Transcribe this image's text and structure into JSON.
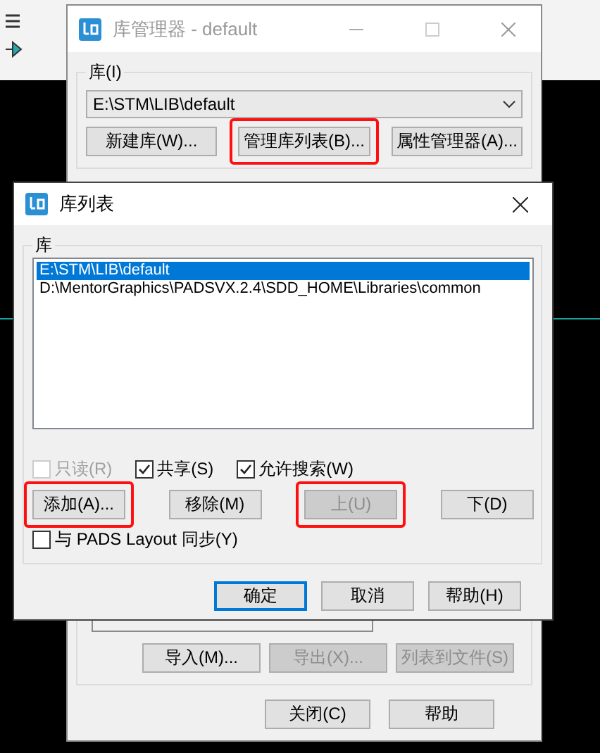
{
  "background_window": {
    "title": "库管理器 - default",
    "library_group": {
      "label": "库(I)",
      "value": "E:\\STM\\LIB\\default"
    },
    "buttons": [
      {
        "label": "新建库(W)...",
        "highlighted": false
      },
      {
        "label": "管理库列表(B)...",
        "highlighted": true
      },
      {
        "label": "属性管理器(A)...",
        "highlighted": false
      }
    ],
    "lower_buttons": [
      {
        "label": "导入(M)...",
        "disabled": false
      },
      {
        "label": "导出(X)...",
        "disabled": true
      },
      {
        "label": "列表到文件(S)",
        "disabled": true
      }
    ],
    "footer_buttons": [
      {
        "label": "关闭(C)"
      },
      {
        "label": "帮助"
      }
    ]
  },
  "dialog": {
    "title": "库列表",
    "group_label": "库",
    "libraries": [
      {
        "path": "E:\\STM\\LIB\\default",
        "selected": true
      },
      {
        "path": "D:\\MentorGraphics\\PADSVX.2.4\\SDD_HOME\\Libraries\\common",
        "selected": false
      }
    ],
    "options": [
      {
        "label": "只读(R)",
        "checked": false,
        "disabled": true
      },
      {
        "label": "共享(S)",
        "checked": true,
        "disabled": false
      },
      {
        "label": "允许搜索(W)",
        "checked": true,
        "disabled": false
      }
    ],
    "actions": [
      {
        "label": "添加(A)...",
        "disabled": false,
        "highlighted": true
      },
      {
        "label": "移除(M)",
        "disabled": false,
        "highlighted": false
      },
      {
        "label": "上(U)",
        "disabled": true,
        "highlighted": true
      },
      {
        "label": "下(D)",
        "disabled": false,
        "highlighted": false
      }
    ],
    "sync": {
      "label": "与 PADS Layout 同步(Y)",
      "checked": false
    },
    "footer_buttons": [
      {
        "label": "确定",
        "default": true
      },
      {
        "label": "取消",
        "default": false
      },
      {
        "label": "帮助(H)",
        "default": false
      }
    ]
  }
}
